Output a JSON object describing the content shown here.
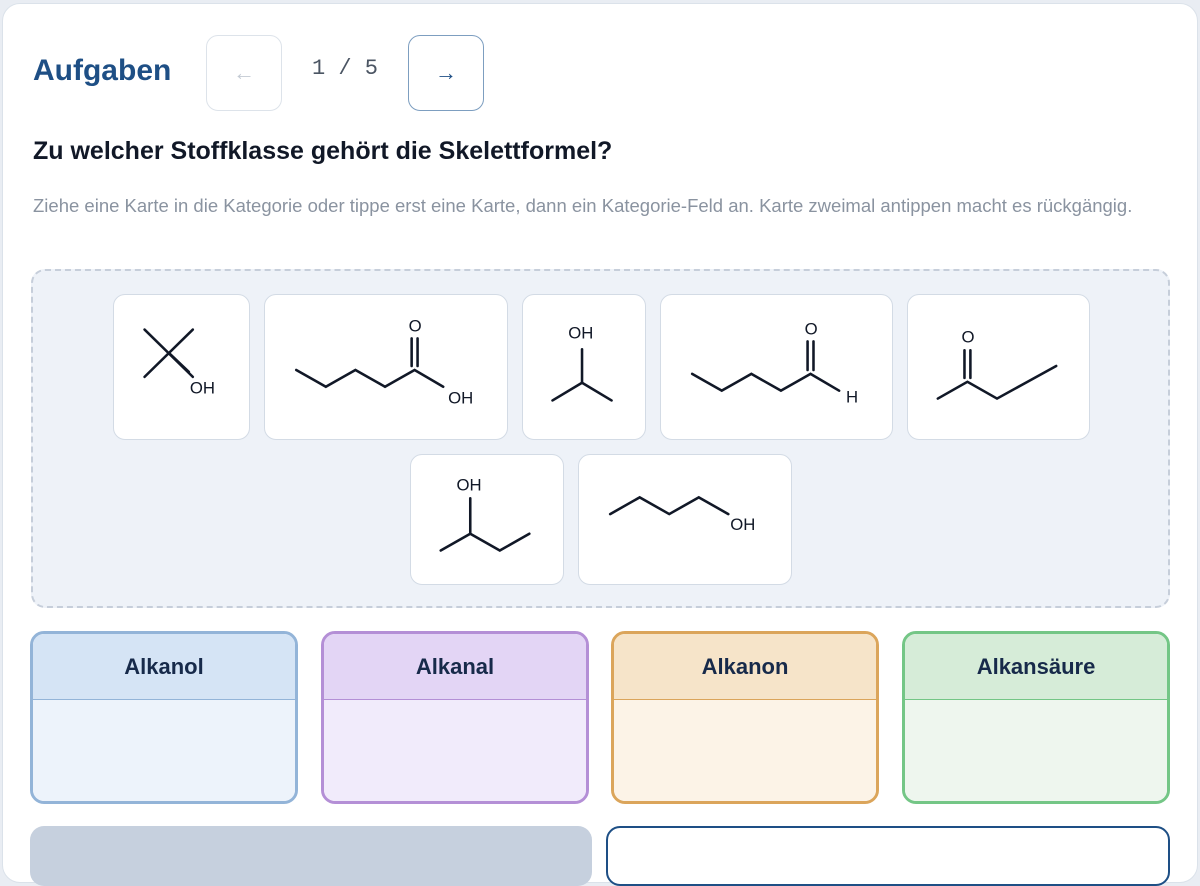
{
  "header": {
    "title": "Aufgaben",
    "prev_label": "←",
    "next_label": "→",
    "counter": "1 / 5"
  },
  "question": "Zu welcher Stoffklasse gehört die Skelettformel?",
  "instructions": "Ziehe eine Karte in die Kategorie oder tippe erst eine Karte, dann ein Kategorie-Feld an. Karte zweimal antippen macht es rückgängig.",
  "cards": [
    {
      "label_oh": "OH"
    },
    {
      "label_o": "O",
      "label_oh": "OH"
    },
    {
      "label_oh": "OH"
    },
    {
      "label_o": "O",
      "label_h": "H"
    },
    {
      "label_o": "O"
    },
    {
      "label_oh": "OH"
    },
    {
      "label_oh": "OH"
    }
  ],
  "categories": [
    {
      "label": "Alkanol",
      "border": "#93b4d8",
      "head_bg": "#d5e4f5",
      "body_bg": "#edf3fb"
    },
    {
      "label": "Alkanal",
      "border": "#b48fd6",
      "head_bg": "#e3d5f5",
      "body_bg": "#f1ebfb"
    },
    {
      "label": "Alkanon",
      "border": "#dba55b",
      "head_bg": "#f6e4c9",
      "body_bg": "#fcf3e7"
    },
    {
      "label": "Alkansäure",
      "border": "#74c686",
      "head_bg": "#d6ecd8",
      "body_bg": "#eef6ee"
    }
  ],
  "colors": {
    "accent": "#1e4f85",
    "bond": "#111827"
  }
}
